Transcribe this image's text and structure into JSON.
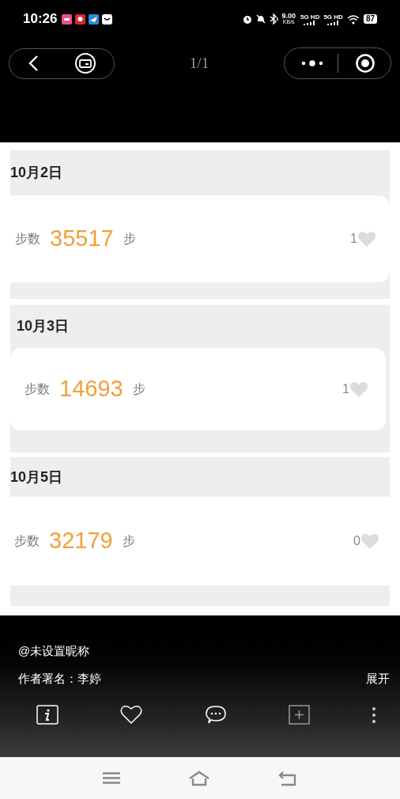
{
  "status_bar": {
    "time": "10:26",
    "net_speed": "9.00",
    "net_unit": "KB/s",
    "sim_1": "5G HD",
    "sim_2": "5G HD",
    "battery": "87"
  },
  "top_bar": {
    "page_counter": "1/1"
  },
  "entries": [
    {
      "date": "10月2日",
      "label": "步数",
      "steps": "35517",
      "unit": "步",
      "likes": "1"
    },
    {
      "date": "10月3日",
      "label": "步数",
      "steps": "14693",
      "unit": "步",
      "likes": "1"
    },
    {
      "date": "10月5日",
      "label": "步数",
      "steps": "32179",
      "unit": "步",
      "likes": "0"
    }
  ],
  "footer": {
    "user": "@未设置昵称",
    "author": "作者署名：李婷",
    "expand": "展开"
  }
}
